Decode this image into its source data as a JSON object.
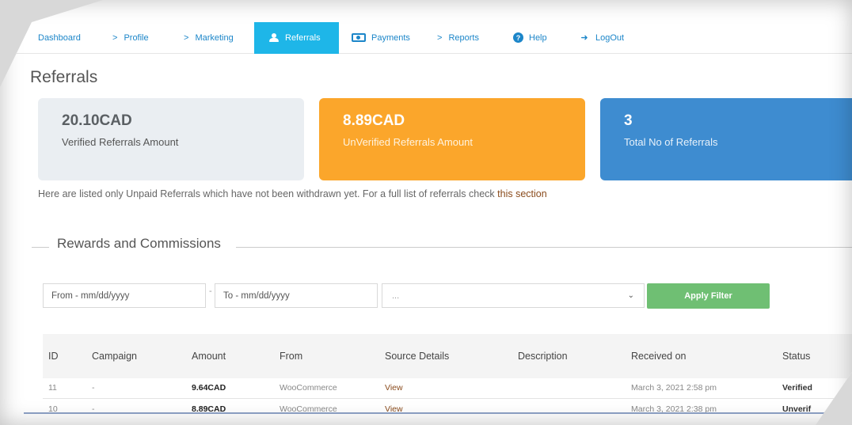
{
  "nav": {
    "items": [
      {
        "label": "Dashboard",
        "glyph": ""
      },
      {
        "label": "Profile",
        "glyph": ">"
      },
      {
        "label": "Marketing",
        "glyph": ">"
      },
      {
        "label": "Referrals",
        "icon": "users-icon"
      },
      {
        "label": "Payments",
        "icon": "money-icon"
      },
      {
        "label": "Reports",
        "glyph": ">"
      },
      {
        "label": "Help",
        "icon": "help-icon"
      },
      {
        "label": "LogOut",
        "icon": "logout-icon"
      }
    ],
    "active": "Referrals",
    "active_color": "#1eb6e8"
  },
  "page": {
    "title": "Referrals"
  },
  "cards": {
    "verified": {
      "amount": "20.10CAD",
      "caption": "Verified Referrals Amount",
      "color": "#eaeef2"
    },
    "unverified": {
      "amount": "8.89CAD",
      "caption": "UnVerified Referrals Amount",
      "color": "#fba62b"
    },
    "total": {
      "amount": "3",
      "caption": "Total No of Referrals",
      "color": "#3e8cd0"
    }
  },
  "info": {
    "text": "Here are listed only Unpaid Referrals which have not been withdrawn yet. For a full list of referrals check ",
    "link": "this section"
  },
  "section": {
    "title": "Rewards and Commissions"
  },
  "filter": {
    "from_placeholder": "From - mm/dd/yyyy",
    "to_placeholder": "To - mm/dd/yyyy",
    "dash": "-",
    "select_value": "...",
    "apply_label": "Apply Filter",
    "apply_color": "#6fbf73"
  },
  "table": {
    "headers": [
      "ID",
      "Campaign",
      "Amount",
      "From",
      "Source Details",
      "Description",
      "Received on",
      "Status"
    ],
    "rows": [
      {
        "id": "11",
        "campaign": "-",
        "amount": "9.64CAD",
        "from": "WooCommerce",
        "source": "View",
        "description": "",
        "received": "March 3, 2021 2:58 pm",
        "status": "Verified"
      },
      {
        "id": "10",
        "campaign": "-",
        "amount": "8.89CAD",
        "from": "WooCommerce",
        "source": "View",
        "description": "",
        "received": "March 3, 2021 2:38 pm",
        "status": "Unverif"
      }
    ]
  }
}
